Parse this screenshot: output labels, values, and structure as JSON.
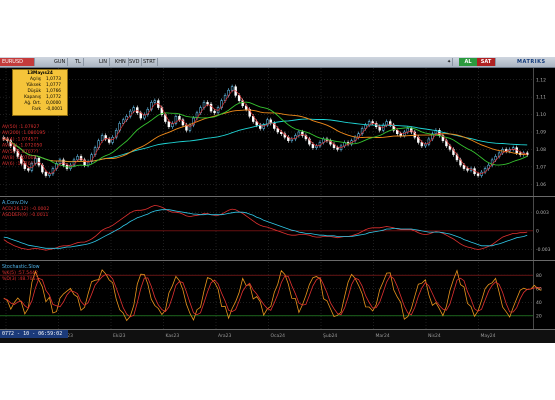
{
  "toolbar": {
    "symbol": "EURUSD",
    "buttons": [
      "GUN",
      "TL",
      "LIN",
      "KHN",
      "SVD",
      "STRT"
    ],
    "al": "AL",
    "sat": "SAT",
    "brand": "MATRIKS"
  },
  "infobox": {
    "date": "13Mayıs24",
    "rows": [
      {
        "label": "Açılış",
        "value": "1,0773"
      },
      {
        "label": "Yüksek",
        "value": "1,0777"
      },
      {
        "label": "Düşük",
        "value": "1,0766"
      },
      {
        "label": "Kapanış",
        "value": "1,0772"
      },
      {
        "label": "Ağ. Ort.",
        "value": "0,0000"
      },
      {
        "label": "Fark",
        "value": "-0,0001"
      }
    ]
  },
  "time_readout": "0772 - 10 - 06:59:02",
  "colors": {
    "up": "#6fd0ff",
    "down": "#ffffff",
    "grid": "#3d3d3d",
    "ma_long": "#1fd6d6",
    "ma_mid": "#f08a1a",
    "ma_short": "#36c430",
    "ma_fast": "#e03030",
    "macd": "#30c8e8",
    "signal": "#e03030",
    "stoch_k": "#e8941c",
    "stoch_d": "#e03030",
    "level_band": "#a02020",
    "zero_line": "#cc2222",
    "low_band": "#2ea02e"
  },
  "chart_data": [
    {
      "type": "candlestick",
      "legend": [
        {
          "label": "AV(50)",
          "value": "1.07927",
          "color": "#e03030"
        },
        {
          "label": "AV(200)",
          "value": "1.080195",
          "color": "#e03030"
        },
        {
          "label": "AV(4)",
          "value": "1.0745??",
          "color": "#e03030"
        },
        {
          "label": "AV(12)",
          "value": "1.072050",
          "color": "#e03030"
        },
        {
          "label": "AV(5)",
          "value": "1.0707??",
          "color": "#e03030"
        },
        {
          "label": "AV(8)",
          "value": "1.07008",
          "color": "#e03030"
        },
        {
          "label": "AV(6)",
          "value": "1.070??",
          "color": "#e03030"
        }
      ],
      "yticks": [
        "1.12",
        "1.11",
        "1.10",
        "1.09",
        "1.08",
        "1.07",
        "1.06"
      ],
      "ylim": [
        1.055,
        1.125
      ],
      "closes": [
        1.086,
        1.085,
        1.082,
        1.079,
        1.076,
        1.072,
        1.069,
        1.068,
        1.072,
        1.075,
        1.071,
        1.067,
        1.065,
        1.066,
        1.069,
        1.072,
        1.074,
        1.071,
        1.069,
        1.071,
        1.074,
        1.076,
        1.074,
        1.071,
        1.073,
        1.077,
        1.081,
        1.085,
        1.088,
        1.086,
        1.084,
        1.087,
        1.091,
        1.095,
        1.097,
        1.099,
        1.102,
        1.104,
        1.101,
        1.098,
        1.1,
        1.103,
        1.107,
        1.108,
        1.104,
        1.1,
        1.096,
        1.093,
        1.095,
        1.099,
        1.097,
        1.094,
        1.091,
        1.094,
        1.098,
        1.101,
        1.104,
        1.107,
        1.106,
        1.102,
        1.101,
        1.104,
        1.108,
        1.111,
        1.114,
        1.116,
        1.111,
        1.108,
        1.105,
        1.103,
        1.099,
        1.096,
        1.094,
        1.092,
        1.094,
        1.097,
        1.095,
        1.092,
        1.09,
        1.089,
        1.087,
        1.085,
        1.086,
        1.088,
        1.09,
        1.088,
        1.086,
        1.083,
        1.081,
        1.082,
        1.084,
        1.086,
        1.085,
        1.083,
        1.081,
        1.08,
        1.082,
        1.084,
        1.083,
        1.085,
        1.087,
        1.089,
        1.092,
        1.094,
        1.096,
        1.095,
        1.093,
        1.091,
        1.094,
        1.096,
        1.094,
        1.091,
        1.089,
        1.088,
        1.09,
        1.092,
        1.09,
        1.087,
        1.084,
        1.082,
        1.083,
        1.086,
        1.089,
        1.091,
        1.088,
        1.085,
        1.082,
        1.08,
        1.077,
        1.074,
        1.071,
        1.069,
        1.068,
        1.069,
        1.066,
        1.065,
        1.067,
        1.069,
        1.071,
        1.074,
        1.076,
        1.078,
        1.08,
        1.079,
        1.08,
        1.081,
        1.078,
        1.077,
        1.078,
        1.077
      ]
    },
    {
      "type": "line",
      "title": "A.Conv.Div",
      "legend": [
        {
          "label": "ACD(26,12)",
          "value": "-0.0002",
          "color": "#e03030"
        },
        {
          "label": "ASDDER(9)",
          "value": "-0.0011",
          "color": "#e03030"
        }
      ],
      "yticks": [
        "0.003",
        "0",
        "-0.003"
      ],
      "ylim": [
        -0.0042,
        0.0048
      ],
      "series": [
        {
          "values": [
            -0.0014,
            -0.0018,
            -0.0021,
            -0.0024,
            -0.0026,
            -0.0028,
            -0.0029,
            -0.003,
            -0.0029,
            -0.0028,
            -0.0029,
            -0.003,
            -0.0031,
            -0.003,
            -0.0029,
            -0.0027,
            -0.0025,
            -0.0024,
            -0.0024,
            -0.0023,
            -0.0021,
            -0.0019,
            -0.0018,
            -0.0018,
            -0.0016,
            -0.0013,
            -0.0009,
            -0.0004,
            0.0001,
            0.0004,
            0.0006,
            0.0009,
            0.0013,
            0.0017,
            0.0021,
            0.0025,
            0.0029,
            0.0032,
            0.0033,
            0.0033,
            0.0034,
            0.0036,
            0.0039,
            0.0041,
            0.004,
            0.0038,
            0.0035,
            0.0032,
            0.003,
            0.003,
            0.0029,
            0.0027,
            0.0024,
            0.0023,
            0.0024,
            0.0025,
            0.0026,
            0.0028,
            0.0028,
            0.0026,
            0.0025,
            0.0025,
            0.0027,
            0.003,
            0.0033,
            0.0035,
            0.0034,
            0.0031,
            0.0028,
            0.0024,
            0.002,
            0.0016,
            0.0012,
            0.0009,
            0.0007,
            0.0006,
            0.0004,
            0.0002,
            0.0,
            -0.0002,
            -0.0004,
            -0.0006,
            -0.0007,
            -0.0007,
            -0.0006,
            -0.0006,
            -0.0006,
            -0.0007,
            -0.0009,
            -0.001,
            -0.001,
            -0.0009,
            -0.0009,
            -0.0009,
            -0.001,
            -0.0011,
            -0.001,
            -0.0009,
            -0.0009,
            -0.0008,
            -0.0006,
            -0.0004,
            -0.0001,
            0.0002,
            0.0004,
            0.0005,
            0.0005,
            0.0005,
            0.0006,
            0.0007,
            0.0006,
            0.0005,
            0.0003,
            0.0002,
            0.0002,
            0.0002,
            0.0002,
            0.0,
            -0.0003,
            -0.0005,
            -0.0006,
            -0.0005,
            -0.0003,
            -0.0001,
            -0.0002,
            -0.0004,
            -0.0007,
            -0.001,
            -0.0013,
            -0.0017,
            -0.0021,
            -0.0024,
            -0.0026,
            -0.0027,
            -0.0029,
            -0.003,
            -0.0029,
            -0.0027,
            -0.0025,
            -0.0022,
            -0.0018,
            -0.0014,
            -0.001,
            -0.0008,
            -0.0006,
            -0.0004,
            -0.0004,
            -0.0003,
            -0.0003,
            -0.0002
          ]
        },
        {
          "values": [
            -0.001,
            -0.0011,
            -0.0013,
            -0.0015,
            -0.0017,
            -0.0019,
            -0.0021,
            -0.0023,
            -0.0024,
            -0.0025,
            -0.0026,
            -0.0027,
            -0.0028,
            -0.0028,
            -0.0028,
            -0.0028,
            -0.0028,
            -0.0027,
            -0.0026,
            -0.0026,
            -0.0025,
            -0.0024,
            -0.0023,
            -0.0022,
            -0.0021,
            -0.0019,
            -0.0017,
            -0.0014,
            -0.0011,
            -0.0008,
            -0.0005,
            -0.0002,
            0.0001,
            0.0004,
            0.0008,
            0.0011,
            0.0015,
            0.0018,
            0.0021,
            0.0023,
            0.0025,
            0.0027,
            0.003,
            0.0032,
            0.0033,
            0.0034,
            0.0034,
            0.0034,
            0.0033,
            0.0032,
            0.0031,
            0.003,
            0.0029,
            0.0028,
            0.0027,
            0.0027,
            0.0026,
            0.0026,
            0.0027,
            0.0026,
            0.0026,
            0.0026,
            0.0026,
            0.0027,
            0.0028,
            0.0029,
            0.003,
            0.003,
            0.003,
            0.0029,
            0.0027,
            0.0025,
            0.0022,
            0.002,
            0.0017,
            0.0015,
            0.0013,
            0.0011,
            0.0009,
            0.0007,
            0.0005,
            0.0003,
            0.0001,
            -0.0,
            -0.0002,
            -0.0003,
            -0.0004,
            -0.0004,
            -0.0005,
            -0.0006,
            -0.0007,
            -0.0007,
            -0.0008,
            -0.0008,
            -0.0008,
            -0.0009,
            -0.0009,
            -0.0009,
            -0.0009,
            -0.0009,
            -0.0008,
            -0.0007,
            -0.0006,
            -0.0005,
            -0.0003,
            -0.0002,
            -0.0001,
            0.0,
            0.0001,
            0.0003,
            0.0003,
            0.0004,
            0.0004,
            0.0003,
            0.0003,
            0.0003,
            0.0003,
            0.0002,
            0.0001,
            0.0,
            -0.0001,
            -0.0002,
            -0.0002,
            -0.0002,
            -0.0002,
            -0.0003,
            -0.0004,
            -0.0005,
            -0.0007,
            -0.0009,
            -0.0011,
            -0.0014,
            -0.0016,
            -0.0018,
            -0.002,
            -0.0022,
            -0.0024,
            -0.0024,
            -0.0024,
            -0.0024,
            -0.0022,
            -0.0021,
            -0.0019,
            -0.0017,
            -0.0015,
            -0.0013,
            -0.0011,
            -0.001,
            -0.0009,
            -0.0007
          ]
        }
      ]
    },
    {
      "type": "line",
      "title": "Stochastic.Slow",
      "legend": [
        {
          "label": "%K(5)",
          "value": "57.5442",
          "color": "#e03030"
        },
        {
          "label": "%D(3)",
          "value": "48.7053",
          "color": "#ffffff"
        }
      ],
      "yticks": [
        "80",
        "60",
        "40",
        "20"
      ],
      "ylim": [
        5,
        95
      ],
      "levels": [
        80,
        20
      ],
      "series": [
        {
          "values": [
            46.2,
            42.6,
            29.8,
            39.6,
            46.3,
            40.2,
            22.8,
            31.1,
            69.5,
            85.6,
            72.9,
            62.7,
            40.9,
            47.3,
            24.2,
            26.2,
            46.2,
            52.3,
            56.5,
            60.5,
            51.4,
            47.9,
            28.2,
            32.6,
            52.3,
            70.3,
            72.6,
            73.5,
            87.8,
            82.1,
            72.9,
            68.7,
            44.8,
            29.0,
            24.1,
            13.1,
            19.1,
            35.5,
            66.9,
            81.4,
            81.0,
            66.9,
            44.5,
            35.3,
            30.8,
            21.8,
            28.5,
            53.7,
            64.3,
            78.2,
            71.9,
            58.3,
            37.2,
            23.4,
            13.9,
            29.1,
            32.8,
            56.6,
            76.4,
            74.4,
            69.0,
            59.3,
            33.8,
            34.0,
            16.5,
            30.6,
            40.7,
            54.2,
            75.3,
            64.8,
            65.9,
            44.9,
            48.5,
            41.0,
            21.1,
            30.2,
            34.0,
            54.5,
            66.8,
            86.6,
            81.2,
            67.0,
            45.8,
            45.6,
            25.1,
            36.2,
            50.2,
            66.4,
            76.2,
            78.0,
            74.7,
            45.3,
            42.1,
            30.2,
            18.9,
            21.0,
            25.2,
            48.5,
            69.7,
            81.1,
            75.4,
            64.9,
            52.8,
            33.2,
            33.0,
            27.1,
            36.4,
            58.4,
            70.0,
            83.1,
            83.5,
            58.4,
            47.8,
            39.7,
            15.0,
            18.8,
            30.5,
            48.9,
            66.6,
            68.1,
            73.1,
            50.8,
            35.5,
            39.4,
            30.4,
            20.4,
            34.1,
            57.4,
            73.6,
            86.8,
            66.1,
            62.5,
            38.4,
            33.6,
            19.3,
            27.4,
            42.8,
            60.1,
            66.2,
            68.7,
            75.3,
            55.2,
            33.1,
            26.0,
            18.3,
            32.5,
            45.4,
            57.8,
            60.7,
            58.8,
            59.4,
            65.1,
            60.4,
            57.5
          ]
        },
        {
          "values": [
            45.5,
            43.8,
            38.9,
            36.7,
            40.4,
            41.8,
            34.9,
            31.1,
            42.2,
            61.0,
            75.2,
            73.1,
            57.6,
            50.6,
            36.9,
            34.9,
            33.3,
            40.6,
            51.0,
            56.9,
            55.6,
            52.6,
            41.2,
            35.6,
            39.2,
            51.7,
            65.3,
            71.8,
            77.6,
            81.0,
            80.2,
            74.4,
            61.1,
            46.9,
            32.0,
            22.4,
            18.5,
            21.0,
            39.5,
            60.6,
            75.7,
            76.0,
            63.4,
            47.3,
            36.2,
            29.2,
            26.3,
            33.1,
            47.7,
            65.0,
            70.7,
            69.0,
            55.3,
            39.3,
            24.3,
            21.6,
            24.5,
            39.2,
            55.1,
            68.6,
            72.8,
            67.1,
            53.4,
            42.1,
            28.3,
            26.3,
            29.0,
            41.9,
            56.5,
            64.1,
            68.1,
            58.1,
            52.2,
            44.3,
            36.9,
            30.8,
            28.1,
            39.4,
            51.7,
            69.0,
            78.8,
            78.0,
            64.5,
            52.5,
            38.9,
            35.8,
            36.8,
            50.1,
            64.2,
            73.2,
            76.4,
            66.1,
            53.9,
            39.2,
            30.5,
            23.5,
            21.7,
            31.6,
            47.7,
            66.3,
            75.6,
            73.5,
            64.0,
            49.7,
            39.8,
            31.4,
            32.1,
            40.1,
            54.8,
            70.0,
            79.1,
            75.0,
            63.4,
            48.8,
            34.5,
            24.4,
            21.5,
            32.4,
            48.7,
            61.0,
            69.2,
            64.0,
            53.0,
            41.9,
            35.1,
            30.0,
            28.1,
            37.3,
            55.0,
            72.6,
            75.5,
            71.8,
            55.8,
            44.7,
            30.4,
            26.8,
            29.8,
            43.4,
            56.4,
            65.0,
            70.1,
            66.4,
            54.5,
            38.1,
            25.8,
            25.6,
            32.0,
            45.2,
            54.6,
            59.1,
            59.6,
            61.1,
            61.6,
            61.0
          ]
        }
      ]
    }
  ],
  "xaxis": {
    "labels": [
      "Ağu23",
      "Eyl23",
      "Eki23",
      "Kas23",
      "Ara23",
      "Oca24",
      "Şub24",
      "Mar24",
      "Nis24",
      "May24"
    ]
  }
}
